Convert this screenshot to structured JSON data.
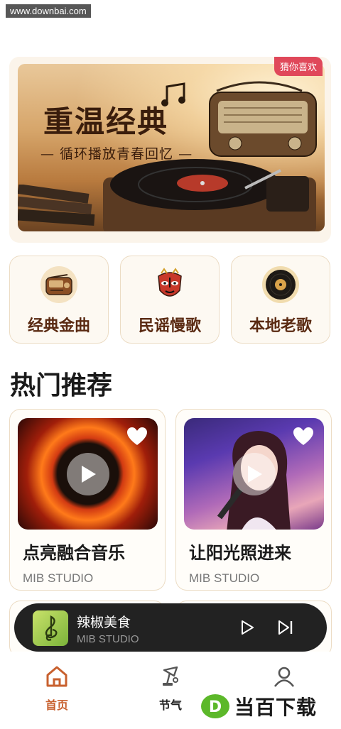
{
  "watermark": {
    "site": "www.downbai.com",
    "brand": "当百下载",
    "brand_badge": "D"
  },
  "banner": {
    "badge": "猜你喜欢",
    "title": "重温经典",
    "subtitle": "— 循环播放青春回忆 —"
  },
  "categories": [
    {
      "label": "经典金曲",
      "icon": "radio-icon"
    },
    {
      "label": "民谣慢歌",
      "icon": "opera-mask-icon"
    },
    {
      "label": "本地老歌",
      "icon": "vinyl-record-icon"
    }
  ],
  "section_title": "热门推荐",
  "recommendations": [
    {
      "title": "点亮融合音乐",
      "artist": "MIB STUDIO"
    },
    {
      "title": "让阳光照进来",
      "artist": "MIB STUDIO"
    }
  ],
  "player": {
    "title": "辣椒美食",
    "artist": "MIB STUDIO"
  },
  "nav": [
    {
      "label": "首页",
      "icon": "home-icon",
      "active": true
    },
    {
      "label": "节气",
      "icon": "festival-icon",
      "active": false
    },
    {
      "label": "",
      "icon": "profile-icon",
      "active": false
    }
  ],
  "colors": {
    "accent": "#c8602e",
    "category_text": "#5a2a12",
    "badge": "#e0485a",
    "player_bg": "#222222"
  }
}
